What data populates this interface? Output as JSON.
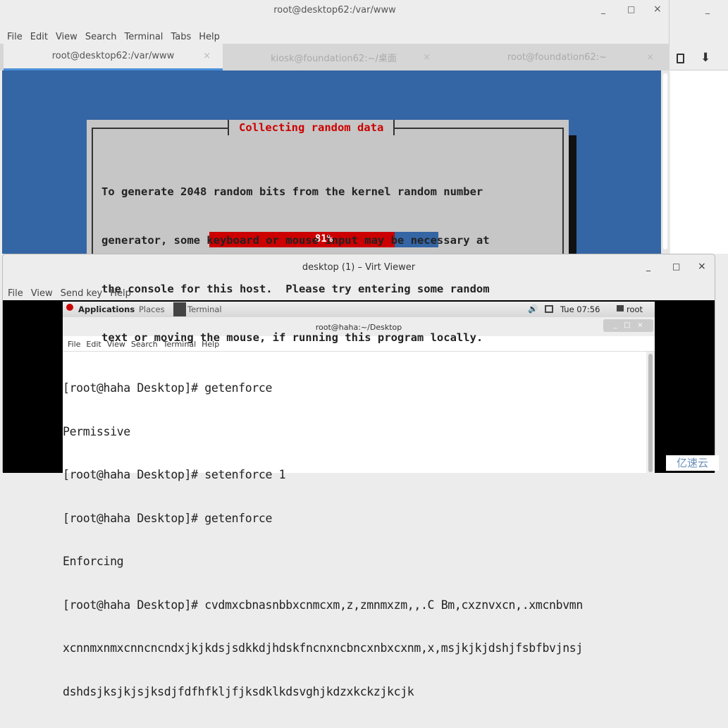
{
  "back_window": {
    "title": "root@desktop62:/var/www",
    "controls": [
      "_",
      "□",
      "×"
    ],
    "menu": [
      "File",
      "Edit",
      "View",
      "Search",
      "Terminal",
      "Tabs",
      "Help"
    ],
    "tabs": [
      {
        "label": "root@desktop62:/var/www",
        "active": true
      },
      {
        "label": "kiosk@foundation62:~/桌面",
        "active": false
      },
      {
        "label": "root@foundation62:~",
        "active": false
      }
    ],
    "tab_close": "×",
    "terminal_bg": "#3465a4",
    "dialog": {
      "title": "Collecting random data",
      "lines": [
        "To generate 2048 random bits from the kernel random number",
        "generator, some keyboard or mouse input may be necessary at",
        "the console for this host.  Please try entering some random",
        "text or moving the mouse, if running this program locally."
      ],
      "progress_percent": 81,
      "progress_label": "81%"
    }
  },
  "side_window": {
    "minimize": "_",
    "icons": [
      "clipboard-icon",
      "download-arrow-icon"
    ]
  },
  "virt_viewer": {
    "title": "desktop (1) – Virt Viewer",
    "controls": [
      "_",
      "□",
      "×"
    ],
    "menu": [
      "File",
      "View",
      "Send key",
      "Help"
    ],
    "guest": {
      "panel": {
        "applications": "Applications",
        "places": "Places",
        "task": "Terminal",
        "clock": "Tue 07:56",
        "user": "root"
      },
      "terminal_title": "root@haha:~/Desktop",
      "terminal_menu": [
        "File",
        "Edit",
        "View",
        "Search",
        "Terminal",
        "Help"
      ],
      "lines": [
        "[root@haha Desktop]# getenforce",
        "Permissive",
        "[root@haha Desktop]# setenforce 1",
        "[root@haha Desktop]# getenforce",
        "Enforcing",
        "[root@haha Desktop]# cvdmxcbnasnbbxcnmcxm,z,zmnmxzm,,.C Bm,cxznvxcn,.xmcnbvmn",
        "xcnnmxnmxcnncncndxjkjkdsjsdkkdjhdskfncnxncbncxnbxcxnm,x,msjkjkjdshjfsbfbvjnsj",
        "dshdsjksjkjsjksdjfdfhfkljfjksdklkdsvghjkdzxkckzjkcjk"
      ]
    }
  },
  "watermark": "亿速云"
}
